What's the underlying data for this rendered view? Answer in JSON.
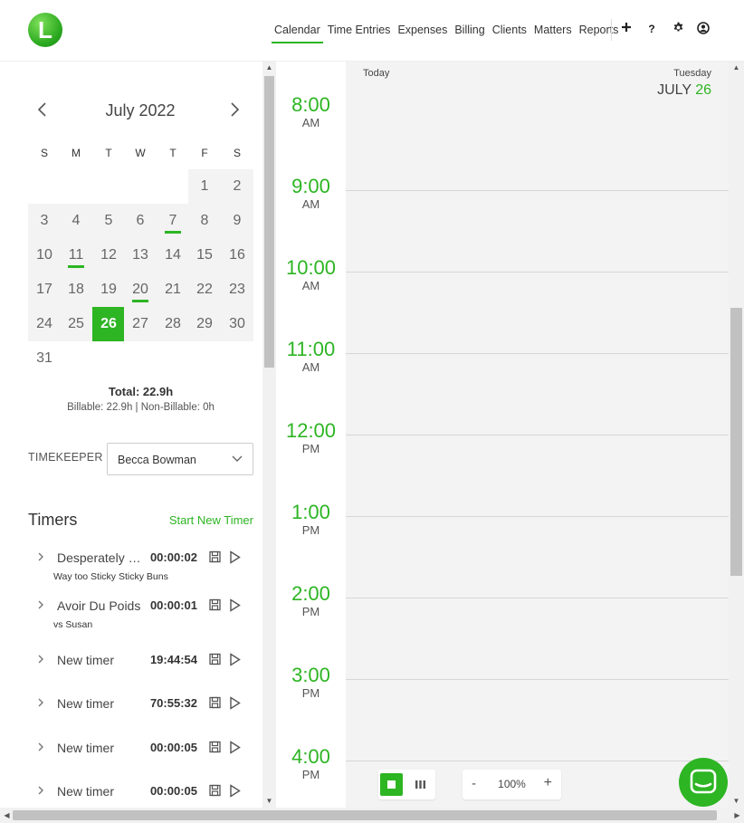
{
  "header": {
    "nav": [
      {
        "label": "Calendar",
        "active": true
      },
      {
        "label": "Time Entries",
        "active": false
      },
      {
        "label": "Expenses",
        "active": false
      },
      {
        "label": "Billing",
        "active": false
      },
      {
        "label": "Clients",
        "active": false
      },
      {
        "label": "Matters",
        "active": false
      },
      {
        "label": "Reports",
        "active": false
      }
    ],
    "icons": [
      "plus-icon",
      "help-icon",
      "gear-icon",
      "user-icon"
    ],
    "logo_letter": "L",
    "help_glyph": "?"
  },
  "mini_calendar": {
    "month_label": "July 2022",
    "weekdays": [
      "S",
      "M",
      "T",
      "W",
      "T",
      "F",
      "S"
    ],
    "weeks": [
      [
        "",
        "",
        "",
        "",
        "",
        "1",
        "2"
      ],
      [
        "3",
        "4",
        "5",
        "6",
        "7",
        "8",
        "9"
      ],
      [
        "10",
        "11",
        "12",
        "13",
        "14",
        "15",
        "16"
      ],
      [
        "17",
        "18",
        "19",
        "20",
        "21",
        "22",
        "23"
      ],
      [
        "24",
        "25",
        "26",
        "27",
        "28",
        "29",
        "30"
      ],
      [
        "31",
        "",
        "",
        "",
        "",
        "",
        ""
      ]
    ],
    "selected_day": "26",
    "marked_days": [
      "7",
      "11",
      "20"
    ],
    "total": "Total: 22.9h",
    "billable_summary": "Billable: 22.9h | Non-Billable: 0h"
  },
  "timekeeper": {
    "label": "TIMEKEEPER",
    "value": "Becca Bowman"
  },
  "timers": {
    "title": "Timers",
    "start_label": "Start New Timer",
    "items": [
      {
        "name": "Desperately Seeking Buns",
        "time": "00:00:02",
        "sub": "Way too Sticky Sticky Buns"
      },
      {
        "name": "Avoir Du Poids",
        "time": "00:00:01",
        "sub": "vs Susan"
      },
      {
        "name": "New timer",
        "time": "19:44:54",
        "sub": ""
      },
      {
        "name": "New timer",
        "time": "70:55:32",
        "sub": ""
      },
      {
        "name": "New timer",
        "time": "00:00:05",
        "sub": ""
      },
      {
        "name": "New timer",
        "time": "00:00:05",
        "sub": ""
      }
    ]
  },
  "day_view": {
    "today_label": "Today",
    "weekday": "Tuesday",
    "month": "JULY",
    "day_num": "26",
    "hours": [
      {
        "time": "8:00",
        "period": "AM"
      },
      {
        "time": "9:00",
        "period": "AM"
      },
      {
        "time": "10:00",
        "period": "AM"
      },
      {
        "time": "11:00",
        "period": "AM"
      },
      {
        "time": "12:00",
        "period": "PM"
      },
      {
        "time": "1:00",
        "period": "PM"
      },
      {
        "time": "2:00",
        "period": "PM"
      },
      {
        "time": "3:00",
        "period": "PM"
      },
      {
        "time": "4:00",
        "period": "PM"
      }
    ]
  },
  "zoom": {
    "minus": "-",
    "value": "100%",
    "plus": "+"
  },
  "colors": {
    "accent": "#2db523",
    "background": "#f3f3f3"
  }
}
